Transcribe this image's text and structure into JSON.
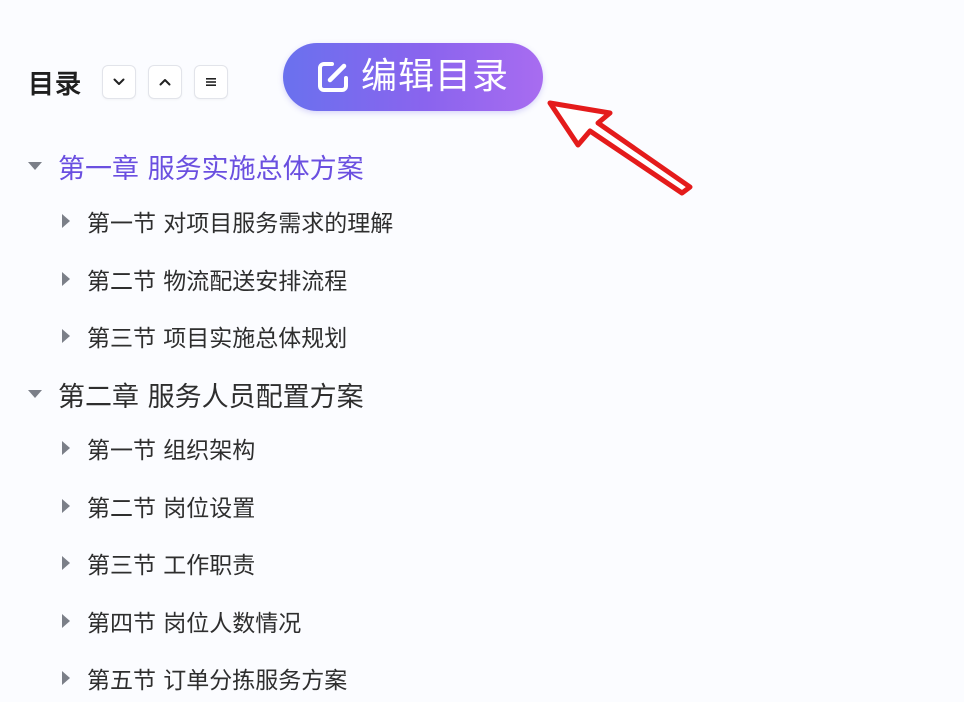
{
  "header": {
    "title": "目录",
    "controls": [
      {
        "name": "expand-all-button",
        "icon": "chevron-down-icon"
      },
      {
        "name": "collapse-all-button",
        "icon": "chevron-up-icon"
      },
      {
        "name": "list-view-button",
        "icon": "menu-lines-icon"
      }
    ],
    "edit_button": {
      "label": "编辑目录",
      "icon": "edit-square-icon",
      "gradient": [
        "#6a71ee",
        "#a86cf0"
      ]
    }
  },
  "annotation": {
    "arrow_color": "#e41b1b"
  },
  "toc": [
    {
      "label": "第一章 服务实施总体方案",
      "expanded": true,
      "active": true,
      "sections": [
        {
          "label": "第一节 对项目服务需求的理解"
        },
        {
          "label": "第二节 物流配送安排流程"
        },
        {
          "label": "第三节 项目实施总体规划"
        }
      ]
    },
    {
      "label": "第二章 服务人员配置方案",
      "expanded": true,
      "active": false,
      "sections": [
        {
          "label": "第一节 组织架构"
        },
        {
          "label": "第二节 岗位设置"
        },
        {
          "label": "第三节 工作职责"
        },
        {
          "label": "第四节 岗位人数情况"
        },
        {
          "label": "第五节 订单分拣服务方案"
        }
      ]
    }
  ],
  "colors": {
    "active_chapter": "#6a4fe0",
    "text": "#2e2e2e",
    "caret": "#7b7f88",
    "background": "#fbfcff"
  }
}
